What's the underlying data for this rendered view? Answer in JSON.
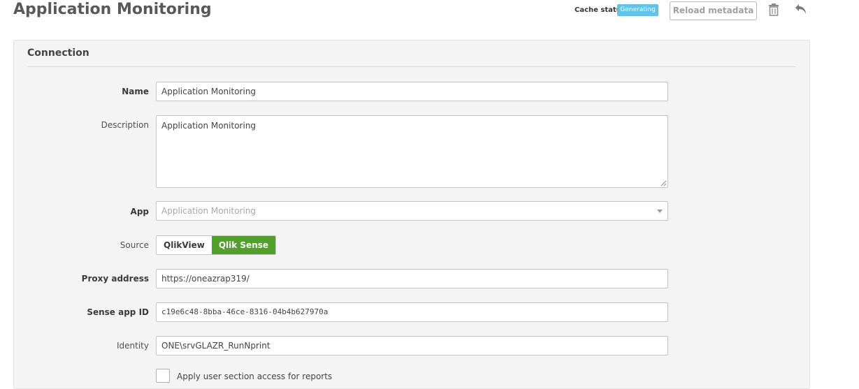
{
  "header": {
    "title": "Application Monitoring",
    "cache_status_label": "Cache status",
    "cache_status_value": "Generating",
    "reload_button": "Reload metadata",
    "icons": {
      "delete": "trash-icon",
      "back": "undo-arrow-icon"
    }
  },
  "connection": {
    "heading": "Connection",
    "fields": {
      "name": {
        "label": "Name",
        "value": "Application Monitoring"
      },
      "description": {
        "label": "Description",
        "value": "Application Monitoring"
      },
      "app": {
        "label": "App",
        "placeholder": "Application Monitoring"
      },
      "source": {
        "label": "Source",
        "options": [
          "QlikView",
          "Qlik Sense"
        ],
        "selected": "Qlik Sense"
      },
      "proxy_address": {
        "label": "Proxy address",
        "value": "https://oneazrap319/"
      },
      "sense_app_id": {
        "label": "Sense app ID",
        "value": "c19e6c48-8bba-46ce-8316-04b4b627970a"
      },
      "identity": {
        "label": "Identity",
        "value": "ONE\\srvGLAZR_RunNprint"
      }
    },
    "section_access": {
      "label": "Apply user section access for reports",
      "checked": false
    }
  },
  "colors": {
    "accent_green": "#52a02b",
    "badge_blue": "#5fc4e8",
    "panel_bg": "#f4f4f4"
  }
}
